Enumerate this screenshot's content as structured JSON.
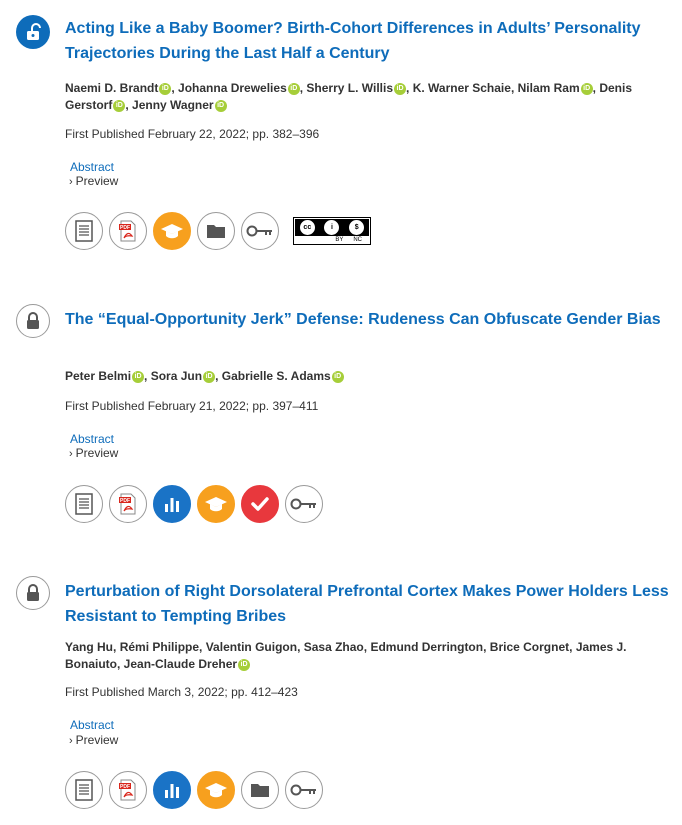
{
  "articles": [
    {
      "access": "open",
      "title": "Acting Like a Baby Boomer? Birth-Cohort Differences in Adults’ Personality Trajectories During the Last Half a Century",
      "authors": [
        "Naemi D. Brandt",
        "Johanna Drewelies",
        "Sherry L. Willis",
        "K. Warner Schaie",
        "Nilam Ram",
        "Denis Gerstorf",
        "Jenny Wagner"
      ],
      "published": "First Published February 22, 2022; pp. 382–396",
      "abstract_label": "Abstract",
      "preview_label": "Preview",
      "actions": [
        "fulltext-icon",
        "pdf-icon",
        "permissions-icon",
        "supplemental-icon",
        "access-key-icon"
      ],
      "license": {
        "labels": [
          "BY",
          "NC"
        ]
      }
    },
    {
      "access": "restricted",
      "title": "The “Equal-Opportunity Jerk” Defense: Rudeness Can Obfuscate Gender Bias",
      "authors": [
        "Peter Belmi",
        "Sora Jun",
        "Gabrielle S. Adams"
      ],
      "published": "First Published February 21, 2022; pp. 397–411",
      "abstract_label": "Abstract",
      "preview_label": "Preview",
      "actions": [
        "fulltext-icon",
        "pdf-icon",
        "metrics-icon",
        "permissions-icon",
        "crossmark-icon",
        "access-key-icon"
      ]
    },
    {
      "access": "restricted",
      "title": "Perturbation of Right Dorsolateral Prefrontal Cortex Makes Power Holders Less Resistant to Tempting Bribes",
      "authors": [
        "Yang Hu",
        "Rémi Philippe",
        "Valentin Guigon",
        "Sasa Zhao",
        "Edmund Derrington",
        "Brice Corgnet",
        "James J. Bonaiuto",
        "Jean-Claude Dreher"
      ],
      "published": "First Published March 3, 2022; pp. 412–423",
      "abstract_label": "Abstract",
      "preview_label": "Preview",
      "actions": [
        "fulltext-icon",
        "pdf-icon",
        "metrics-icon",
        "permissions-icon",
        "supplemental-icon",
        "access-key-icon"
      ]
    }
  ]
}
